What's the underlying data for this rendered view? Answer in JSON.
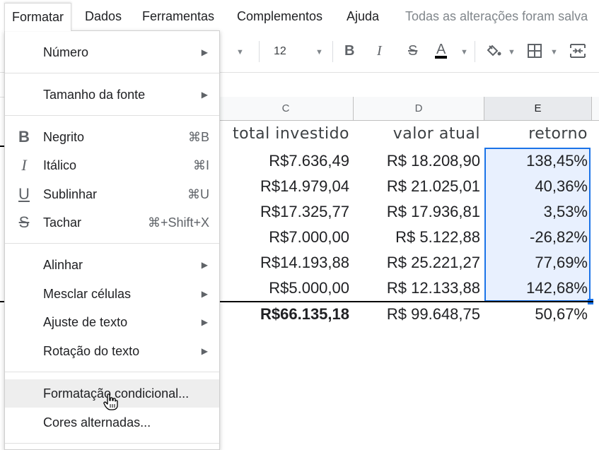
{
  "menubar": {
    "items": [
      "Formatar",
      "Dados",
      "Ferramentas",
      "Complementos",
      "Ajuda"
    ],
    "status": "Todas as alterações foram salva"
  },
  "toolbar": {
    "font_size": "12",
    "bold": "B",
    "italic": "I",
    "strike": "S",
    "text_color": "A"
  },
  "columns": [
    "C",
    "D",
    "E"
  ],
  "headers": [
    "total investido",
    "valor atual",
    "retorno"
  ],
  "rows": [
    [
      "R$7.636,49",
      "R$ 18.208,90",
      "138,45%"
    ],
    [
      "R$14.979,04",
      "R$ 21.025,01",
      "40,36%"
    ],
    [
      "R$17.325,77",
      "R$ 17.936,81",
      "3,53%"
    ],
    [
      "R$7.000,00",
      "R$ 5.122,88",
      "-26,82%"
    ],
    [
      "R$14.193,88",
      "R$ 25.221,27",
      "77,69%"
    ],
    [
      "R$5.000,00",
      "R$ 12.133,88",
      "142,68%"
    ]
  ],
  "totals": [
    "R$66.135,18",
    "R$ 99.648,75",
    "50,67%"
  ],
  "menu": {
    "numero": "Número",
    "tamanho_fonte": "Tamanho da fonte",
    "negrito": "Negrito",
    "negrito_sc": "⌘B",
    "italico": "Itálico",
    "italico_sc": "⌘I",
    "sublinhar": "Sublinhar",
    "sublinhar_sc": "⌘U",
    "tachar": "Tachar",
    "tachar_sc": "⌘+Shift+X",
    "alinhar": "Alinhar",
    "mesclar": "Mesclar células",
    "ajuste": "Ajuste de texto",
    "rotacao": "Rotação do texto",
    "condicional": "Formatação condicional...",
    "cores": "Cores alternadas..."
  },
  "colors": {
    "selection": "#1a73e8",
    "selection_fill": "#e8f0fe"
  }
}
